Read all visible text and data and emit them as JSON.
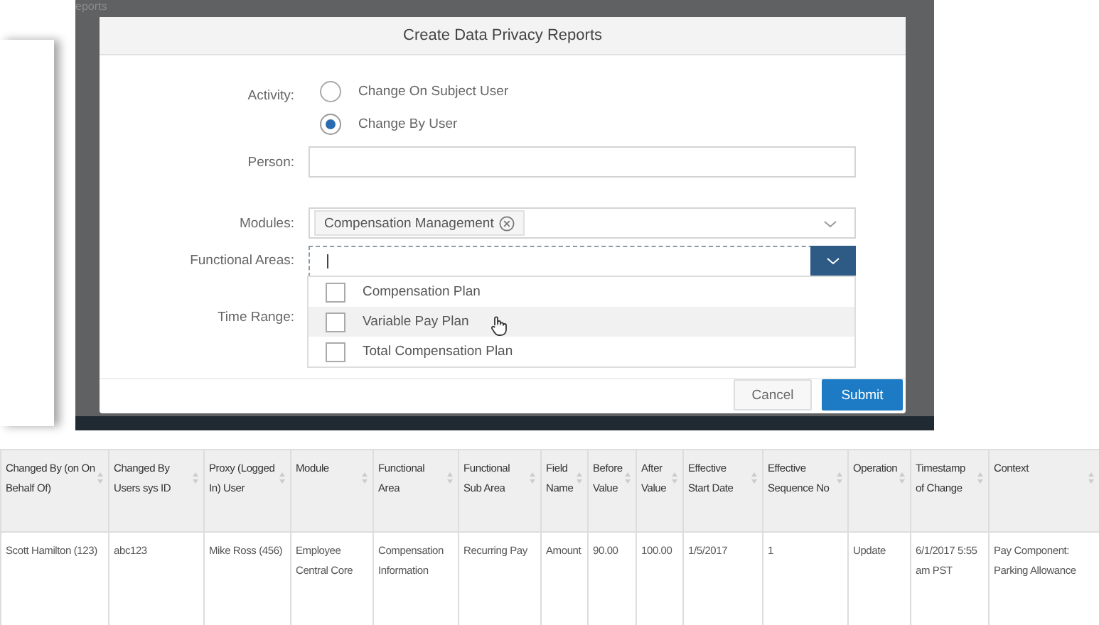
{
  "background": {
    "page_title": "eports"
  },
  "dialog": {
    "title": "Create Data Privacy Reports",
    "activity": {
      "label": "Activity:",
      "options": [
        {
          "label": "Change On Subject User",
          "selected": false
        },
        {
          "label": "Change By User",
          "selected": true
        }
      ]
    },
    "person": {
      "label": "Person:"
    },
    "modules": {
      "label": "Modules:",
      "tokens": [
        "Compensation Management"
      ]
    },
    "functional_areas": {
      "label": "Functional Areas:",
      "expanded": true,
      "options": [
        {
          "label": "Compensation Plan",
          "checked": false,
          "highlighted": false
        },
        {
          "label": "Variable Pay Plan",
          "checked": false,
          "highlighted": true
        },
        {
          "label": "Total Compensation Plan",
          "checked": false,
          "highlighted": false
        }
      ]
    },
    "time_range": {
      "label": "Time Range:"
    },
    "buttons": [
      {
        "label": "Cancel",
        "kind": "secondary"
      },
      {
        "label": "Submit",
        "kind": "primary"
      }
    ]
  },
  "table": {
    "columns": [
      {
        "label": "Changed By (on On Behalf Of)"
      },
      {
        "label": "Changed By Users sys ID"
      },
      {
        "label": "Proxy (Logged In) User"
      },
      {
        "label": "Module"
      },
      {
        "label": "Functional Area"
      },
      {
        "label": "Functional Sub Area"
      },
      {
        "label": "Field Name"
      },
      {
        "label": "Before Value"
      },
      {
        "label": "After Value"
      },
      {
        "label": "Effective Start Date"
      },
      {
        "label": "Effective Sequence No"
      },
      {
        "label": "Operation"
      },
      {
        "label": "Timestamp of Change"
      },
      {
        "label": "Context"
      }
    ],
    "rows": [
      [
        "Scott Hamilton (123)",
        "abc123",
        "Mike Ross (456)",
        "Employee Central Core",
        "Compensation Information",
        "Recurring Pay",
        "Amount",
        "90.00",
        "100.00",
        "1/5/2017",
        "1",
        "Update",
        "6/1/2017 5:55 am PST",
        "Pay Component: Parking Allowance"
      ]
    ]
  }
}
